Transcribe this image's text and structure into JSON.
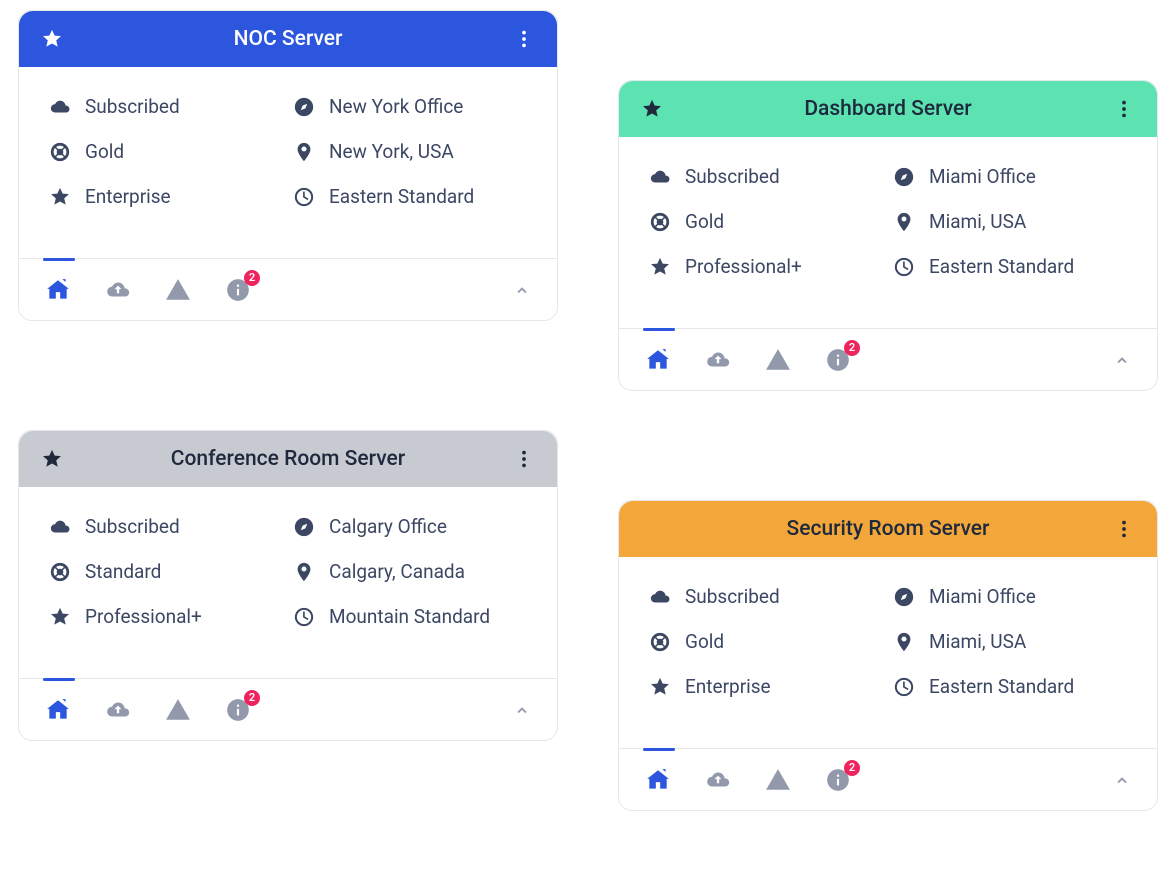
{
  "badge_count": "2",
  "info_icons": [
    "cloud",
    "compass",
    "lifering",
    "pin",
    "star",
    "clock"
  ],
  "footer_icons": [
    "home",
    "cloud-upload",
    "warning",
    "info"
  ],
  "cards": [
    {
      "id": "noc",
      "header_color": "blue",
      "header_text_light": true,
      "title": "NOC Server",
      "has_star": true,
      "info": {
        "subscription": "Subscribed",
        "office": "New York Office",
        "support": "Gold",
        "location": "New York, USA",
        "plan": "Enterprise",
        "timezone": "Eastern Standard"
      }
    },
    {
      "id": "dashboard",
      "header_color": "green",
      "header_text_light": false,
      "title": "Dashboard Server",
      "has_star": true,
      "info": {
        "subscription": "Subscribed",
        "office": "Miami Office",
        "support": "Gold",
        "location": "Miami, USA",
        "plan": "Professional+",
        "timezone": "Eastern Standard"
      }
    },
    {
      "id": "conference",
      "header_color": "gray",
      "header_text_light": false,
      "title": "Conference Room Server",
      "has_star": true,
      "info": {
        "subscription": "Subscribed",
        "office": "Calgary Office",
        "support": "Standard",
        "location": "Calgary, Canada",
        "plan": "Professional+",
        "timezone": "Mountain Standard"
      }
    },
    {
      "id": "security",
      "header_color": "orange",
      "header_text_light": false,
      "title": "Security Room Server",
      "has_star": false,
      "info": {
        "subscription": "Subscribed",
        "office": "Miami Office",
        "support": "Gold",
        "location": "Miami, USA",
        "plan": "Enterprise",
        "timezone": "Eastern Standard"
      }
    }
  ]
}
